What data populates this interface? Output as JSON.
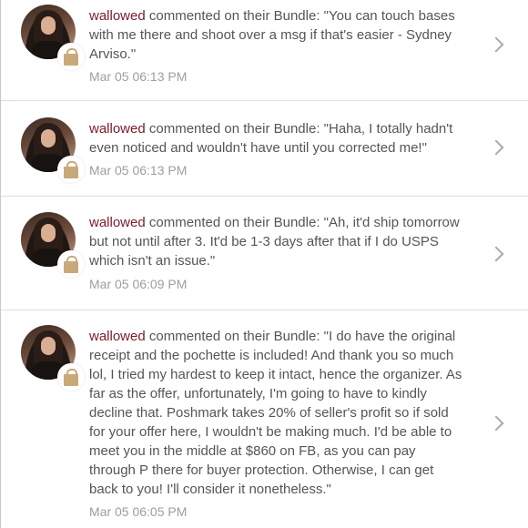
{
  "activity": [
    {
      "user": "wallowed",
      "action": " commented on their Bundle: ",
      "comment": "\"You can touch bases with me there and shoot over a msg if that's easier - Sydney Arviso.\"",
      "time": "Mar 05 06:13 PM",
      "avatar_icon": "user-avatar-photo",
      "badge_icon": "shopping-bag-icon"
    },
    {
      "user": "wallowed",
      "action": " commented on their Bundle: ",
      "comment": "\"Haha, I totally hadn't even noticed and wouldn't have until you corrected me!\"",
      "time": "Mar 05 06:13 PM",
      "avatar_icon": "user-avatar-photo",
      "badge_icon": "shopping-bag-icon"
    },
    {
      "user": "wallowed",
      "action": " commented on their Bundle: ",
      "comment": "\"Ah, it'd ship tomorrow but not until after 3. It'd be 1-3 days after that if I do USPS which isn't an issue.\"",
      "time": "Mar 05 06:09 PM",
      "avatar_icon": "user-avatar-photo",
      "badge_icon": "shopping-bag-icon"
    },
    {
      "user": "wallowed",
      "action": " commented on their Bundle: ",
      "comment": "\"I do have the original receipt and the pochette is included! And thank you so much lol, I tried my hardest to keep it intact, hence the organizer. As far as the offer, unfortunately, I'm going to have to kindly decline that. Poshmark takes 20% of seller's profit so if sold for your offer here, I wouldn't be making much. I'd be able to meet you in the middle at $860 on FB, as you can pay through P there for buyer protection. Otherwise, I can get back to you! I'll consider it nonetheless.\"",
      "time": "Mar 05 06:05 PM",
      "avatar_icon": "user-avatar-photo",
      "badge_icon": "shopping-bag-icon"
    }
  ],
  "colors": {
    "username": "#7a1b2a",
    "body_text": "#555555",
    "timestamp": "#a39c98",
    "bag": "#c9a97a"
  },
  "chevron_icon": "chevron-right-icon"
}
